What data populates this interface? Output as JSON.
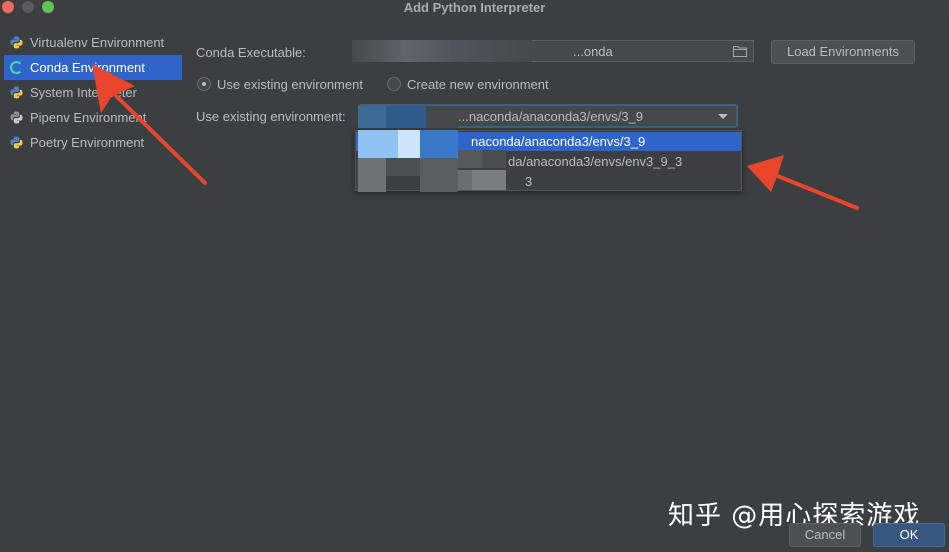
{
  "window": {
    "title": "Add Python Interpreter"
  },
  "sidebar": {
    "items": [
      {
        "label": "Virtualenv Environment",
        "icon": "python-icon"
      },
      {
        "label": "Conda Environment",
        "icon": "conda-icon",
        "selected": true
      },
      {
        "label": "System Interpreter",
        "icon": "python-icon"
      },
      {
        "label": "Pipenv Environment",
        "icon": "python-icon"
      },
      {
        "label": "Poetry Environment",
        "icon": "python-icon"
      }
    ]
  },
  "form": {
    "conda_executable_label": "Conda Executable:",
    "conda_executable_value": "...onda",
    "load_button": "Load Environments",
    "radio_existing": "Use existing environment",
    "radio_new": "Create new environment",
    "existing_label": "Use existing environment:",
    "existing_value": "...naconda/anaconda3/envs/3_9",
    "dropdown_options": [
      {
        "label": "naconda/anaconda3/envs/3_9",
        "selected": true
      },
      {
        "label": "da/anaconda3/envs/env3_9_3",
        "selected": false
      },
      {
        "label": "3",
        "selected": false
      }
    ]
  },
  "footer": {
    "cancel": "Cancel",
    "ok": "OK"
  },
  "watermark": "知乎 @用心探索游戏",
  "colors": {
    "background": "#3c3f41",
    "selection": "#2f65ca",
    "arrow": "#e8452c"
  }
}
